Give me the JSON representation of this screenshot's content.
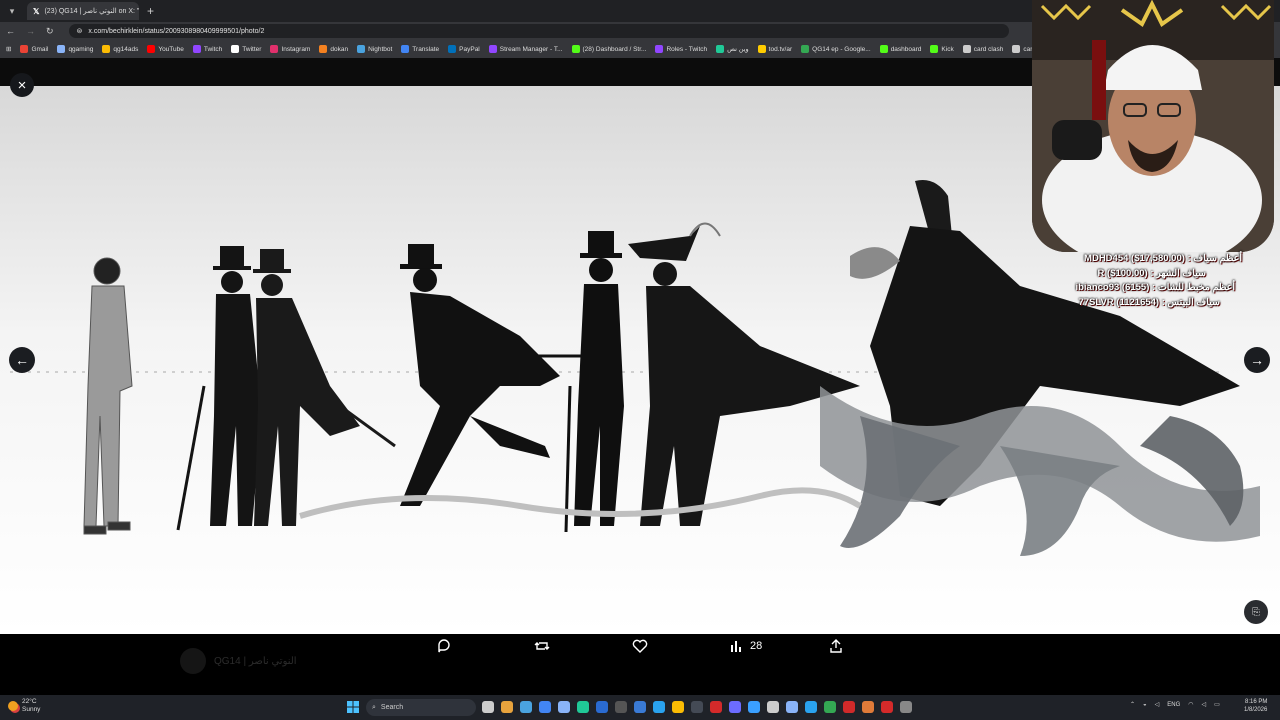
{
  "browser": {
    "tab_title": "(23) QG14 | النوتي ناصر on X: \"...",
    "url": "x.com/bechirklein/status/2009308980409999501/photo/2",
    "bookmarks": [
      {
        "label": "Gmail",
        "color": "#ea4335"
      },
      {
        "label": "qgaming",
        "color": "#8ab4f8"
      },
      {
        "label": "qg14ads",
        "color": "#fbbc04"
      },
      {
        "label": "YouTube",
        "color": "#ff0000"
      },
      {
        "label": "Twitch",
        "color": "#9146ff"
      },
      {
        "label": "Twitter",
        "color": "#ffffff"
      },
      {
        "label": "Instagram",
        "color": "#e1306c"
      },
      {
        "label": "dokan",
        "color": "#f48120"
      },
      {
        "label": "Nightbot",
        "color": "#4aa3df"
      },
      {
        "label": "Translate",
        "color": "#4285f4"
      },
      {
        "label": "PayPal",
        "color": "#0070ba"
      },
      {
        "label": "Stream Manager - T...",
        "color": "#9146ff"
      },
      {
        "label": "(28) Dashboard / Str...",
        "color": "#53fc18"
      },
      {
        "label": "Roles - Twitch",
        "color": "#9146ff"
      },
      {
        "label": "وين نص",
        "color": "#20c997"
      },
      {
        "label": "tod.tv/ar",
        "color": "#ffcc00"
      },
      {
        "label": "QG14 ep - Google...",
        "color": "#34a853"
      },
      {
        "label": "dashboard",
        "color": "#53fc18"
      },
      {
        "label": "Kick",
        "color": "#53fc18"
      },
      {
        "label": "card clash",
        "color": "#cccccc"
      },
      {
        "label": "card clash football",
        "color": "#cccccc"
      }
    ]
  },
  "post": {
    "ghost_author": "QG14 | النوتي ناصر",
    "actions": {
      "views_count": "28"
    }
  },
  "overlay": {
    "donations": [
      "MDHD454 ($17,580.00) : أعظم سياف",
      "R ($100.00) : سياف الشهر",
      "ibianco93 (6155) : أعظم مخبط للشات",
      "77SLVR (1121654) : سياف البيتس"
    ]
  },
  "taskbar": {
    "temperature": "22°C",
    "condition": "Sunny",
    "search_label": "Search",
    "language": "ENG",
    "time": "8:16 PM",
    "date": "1/8/2026",
    "app_colors": [
      "#cccccc",
      "#e8a33d",
      "#4aa3df",
      "#4285f4",
      "#8ab4f8",
      "#20c997",
      "#2a6bd1",
      "#555555",
      "#3a7bd5",
      "#2aa3ef",
      "#fbbc04",
      "#444a55",
      "#d42a2a",
      "#6c6cff",
      "#3aa0ff",
      "#cccccc",
      "#8ab4f8",
      "#2aa3ef",
      "#34a853",
      "#d12a2a",
      "#e07b39",
      "#d42a2a",
      "#888888"
    ]
  }
}
